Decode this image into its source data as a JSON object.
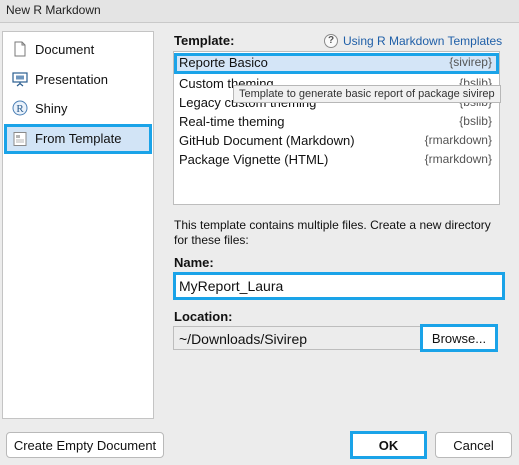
{
  "window": {
    "title": "New R Markdown"
  },
  "sidebar": {
    "items": [
      {
        "label": "Document",
        "selected": false,
        "icon": "document-icon"
      },
      {
        "label": "Presentation",
        "selected": false,
        "icon": "presentation-icon"
      },
      {
        "label": "Shiny",
        "selected": false,
        "icon": "shiny-icon",
        "icon_glyph": "R"
      },
      {
        "label": "From Template",
        "selected": true,
        "icon": "template-icon"
      }
    ]
  },
  "template_section": {
    "label": "Template:",
    "help_link": {
      "icon": "help-icon",
      "icon_glyph": "?",
      "text": "Using R Markdown Templates"
    },
    "templates": [
      {
        "name": "Reporte Basico",
        "package": "{sivirep}",
        "selected": true
      },
      {
        "name": "Custom theming",
        "package": "{bslib}",
        "selected": false
      },
      {
        "name": "Legacy custom theming",
        "package": "{bslib}",
        "selected": false
      },
      {
        "name": "Real-time theming",
        "package": "{bslib}",
        "selected": false
      },
      {
        "name": "GitHub Document (Markdown)",
        "package": "{rmarkdown}",
        "selected": false
      },
      {
        "name": "Package Vignette (HTML)",
        "package": "{rmarkdown}",
        "selected": false
      }
    ],
    "tooltip": "Template to generate basic report of package sivirep"
  },
  "description": "This template contains multiple files. Create a new directory for these files:",
  "name_field": {
    "label": "Name:",
    "value": "MyReport_Laura"
  },
  "location_field": {
    "label": "Location:",
    "value": "~/Downloads/Sivirep",
    "browse_label": "Browse..."
  },
  "footer": {
    "create_empty_label": "Create Empty Document",
    "ok_label": "OK",
    "cancel_label": "Cancel"
  },
  "colors": {
    "highlight": "#1aa3e8",
    "selection": "#d4e5f7",
    "link": "#1f5fa8"
  }
}
